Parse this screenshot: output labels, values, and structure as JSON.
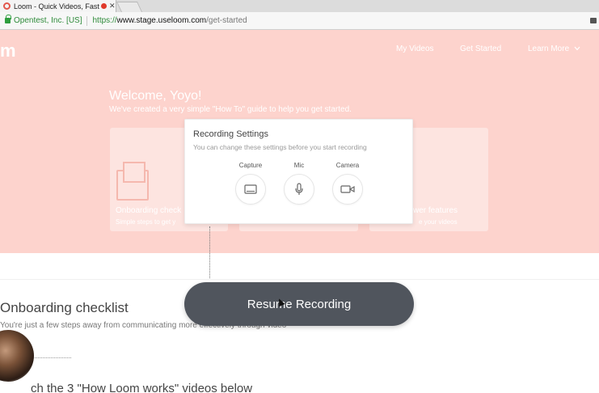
{
  "browser": {
    "tab_title": "Loom - Quick Videos, Faste",
    "tab_close": "✕",
    "url_org": "Opentest, Inc. [US]",
    "url_scheme": "https://",
    "url_host": "www.stage.useloom.com",
    "url_path": "/get-started"
  },
  "header": {
    "logo": "m",
    "nav": {
      "my_videos": "My Videos",
      "get_started": "Get Started",
      "learn_more": "Learn More"
    }
  },
  "hero": {
    "welcome": "Welcome, Yoyo!",
    "subtitle": "We've created a very simple \"How To\" guide to help you get started."
  },
  "cards": {
    "onboarding_title": "Onboarding check",
    "onboarding_desc": "Simple steps to get y",
    "features_title": "wer features",
    "features_desc": "e your videos"
  },
  "settings": {
    "title": "Recording Settings",
    "subtitle": "You can change these settings before you start recording",
    "options": [
      {
        "label": "Capture",
        "icon": "monitor-icon"
      },
      {
        "label": "Mic",
        "icon": "microphone-icon"
      },
      {
        "label": "Camera",
        "icon": "camera-icon"
      }
    ]
  },
  "resume": {
    "label": "Resume Recording"
  },
  "content": {
    "checklist_title": "Onboarding checklist",
    "checklist_sub": "You're just a few steps away from communicating more effectively through video",
    "bottom_text": "ch the 3 \"How Loom works\" videos below"
  },
  "colors": {
    "hero_bg": "#fdd3cd",
    "button_bg": "#50555d",
    "url_green": "#2e8b3a"
  }
}
